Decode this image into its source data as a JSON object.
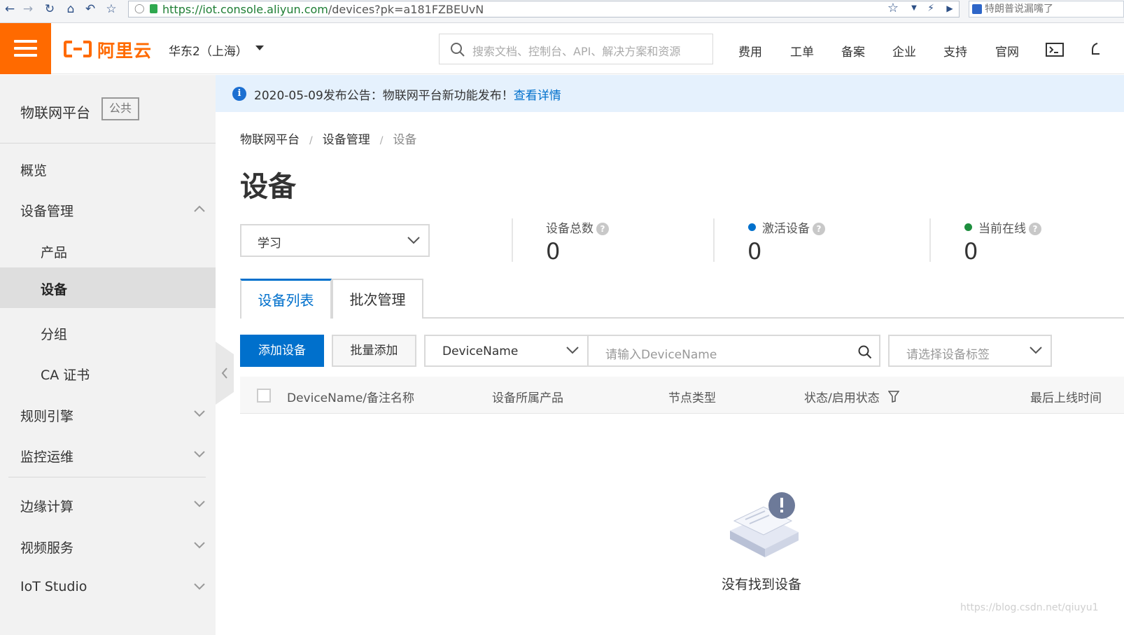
{
  "browser": {
    "url_host": "https://iot.console.aliyun.com",
    "url_path": "/devices?pk=a181FZBEUvN",
    "news_text": "特朗普说漏嘴了"
  },
  "topnav": {
    "logo_text": "阿里云",
    "region": "华东2（上海）",
    "search_placeholder": "搜索文档、控制台、API、解决方案和资源",
    "items": [
      "费用",
      "工单",
      "备案",
      "企业",
      "支持",
      "官网"
    ],
    "brand_color": "#ff6a00"
  },
  "sidebar": {
    "title": "物联网平台",
    "badge": "公共",
    "items": [
      {
        "label": "概览"
      },
      {
        "label": "设备管理"
      },
      {
        "label": "产品"
      },
      {
        "label": "设备"
      },
      {
        "label": "分组"
      },
      {
        "label": "CA 证书"
      },
      {
        "label": "规则引擎"
      },
      {
        "label": "监控运维"
      },
      {
        "label": "边缘计算"
      },
      {
        "label": "视频服务"
      },
      {
        "label": "IoT Studio"
      }
    ],
    "active": "设备"
  },
  "notice": {
    "text": "2020-05-09发布公告：物联网平台新功能发布！",
    "link": "查看详情"
  },
  "breadcrumb": [
    "物联网平台",
    "设备管理",
    "设备"
  ],
  "page_title": "设备",
  "product_select": "学习",
  "stats": [
    {
      "label": "设备总数",
      "value": "0"
    },
    {
      "label": "激活设备",
      "value": "0",
      "dot_color": "#0070cc"
    },
    {
      "label": "当前在线",
      "value": "0",
      "dot_color": "#1e8e3e"
    }
  ],
  "tabs": [
    "设备列表",
    "批次管理"
  ],
  "toolbar": {
    "add_label": "添加设备",
    "batch_label": "批量添加",
    "field_select": "DeviceName",
    "name_placeholder": "请输入DeviceName",
    "tag_placeholder": "请选择设备标签"
  },
  "table": {
    "columns": [
      "DeviceName/备注名称",
      "设备所属产品",
      "节点类型",
      "状态/启用状态",
      "最后上线时间"
    ]
  },
  "empty_text": "没有找到设备",
  "watermark": "https://blog.csdn.net/qiuyu1",
  "accent_color": "#0070cc"
}
